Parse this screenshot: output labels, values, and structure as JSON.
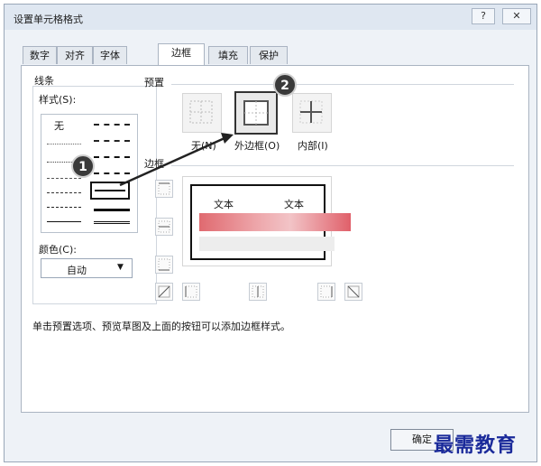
{
  "window": {
    "title": "设置单元格格式",
    "help_label": "?",
    "close_label": "✕"
  },
  "tabs": [
    {
      "label": "数字"
    },
    {
      "label": "对齐"
    },
    {
      "label": "字体"
    },
    {
      "label": "边框",
      "active": true
    },
    {
      "label": "填充"
    },
    {
      "label": "保护"
    }
  ],
  "line": {
    "group_title": "线条",
    "style_label": "样式(S):",
    "none_label": "无",
    "color_label": "颜色(C):",
    "color_value": "自动",
    "dropdown_arrow": "▼"
  },
  "presets": {
    "title": "预置",
    "none": "无(N)",
    "outline": "外边框(O)",
    "inside": "内部(I)"
  },
  "border": {
    "title": "边框",
    "preview_text_1": "文本",
    "preview_text_2": "文本"
  },
  "hint": "单击预置选项、预览草图及上面的按钮可以添加边框样式。",
  "markers": {
    "first": "1",
    "second": "2"
  },
  "buttons": {
    "ok": "确定"
  },
  "watermark": "最需教育",
  "colors": {
    "accent": "#3a3a3a",
    "redaction_red": "#e06a70",
    "tab_border": "#aab4c2"
  }
}
